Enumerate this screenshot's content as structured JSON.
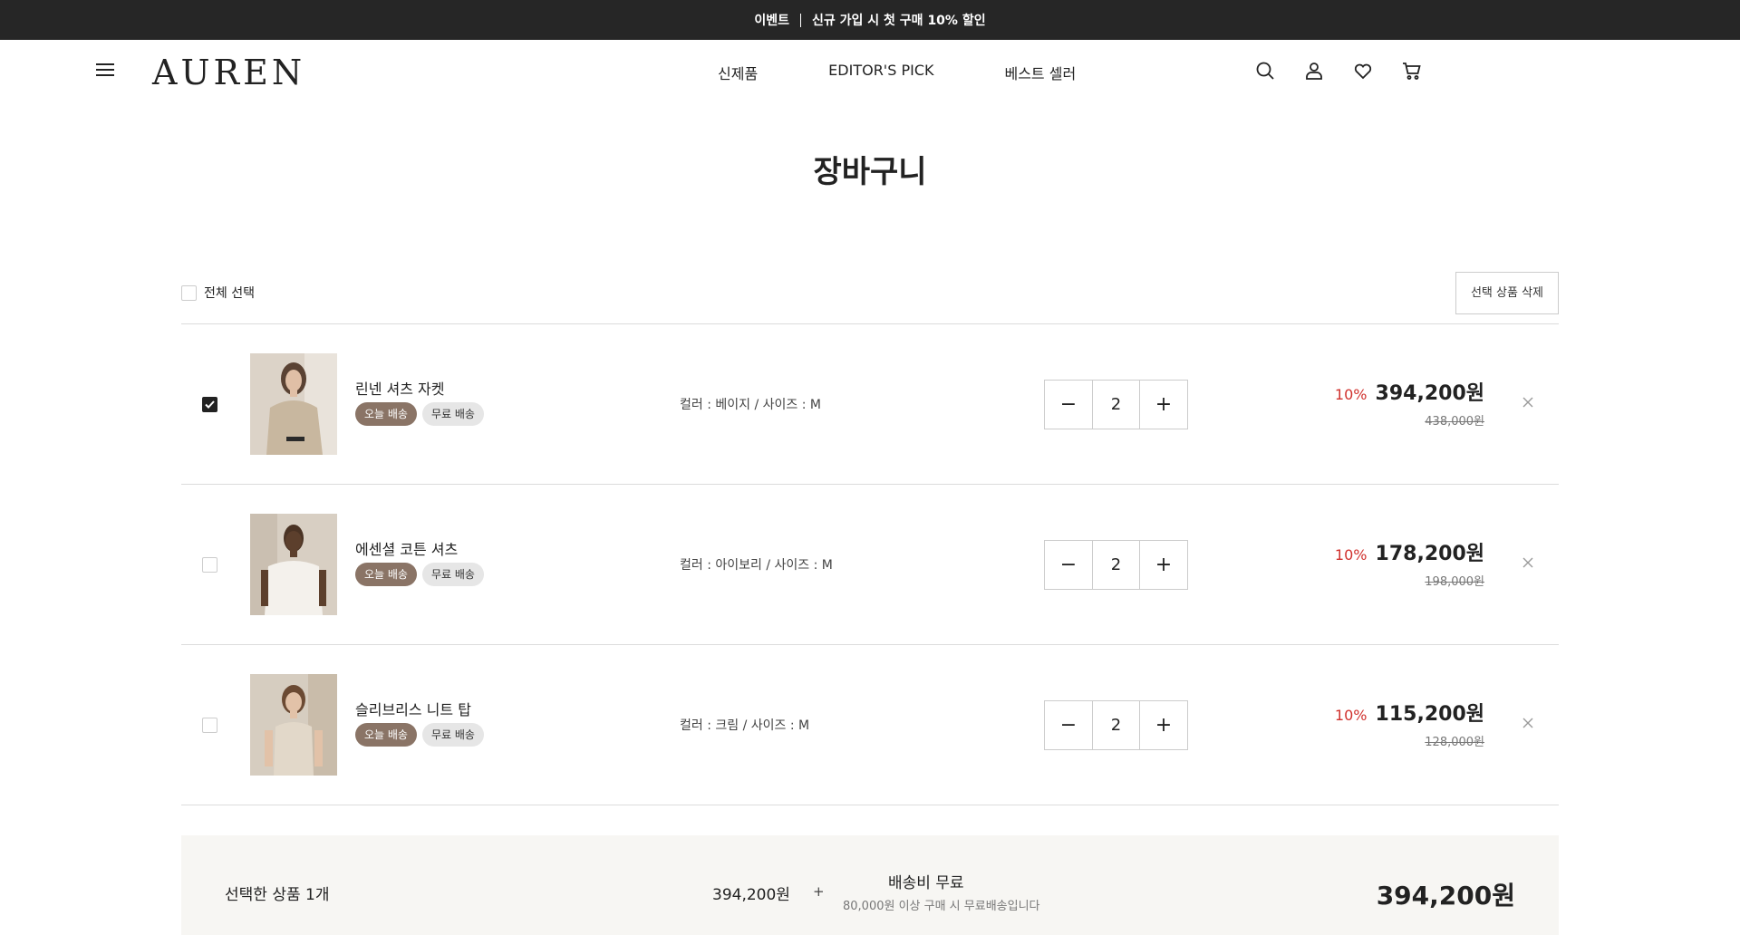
{
  "topbar": {
    "label": "이벤트",
    "text": "신규 가입 시 첫 구매 10% 할인"
  },
  "header": {
    "logo": "AUREN",
    "nav": [
      "신제품",
      "EDITOR'S PICK",
      "베스트 셀러"
    ]
  },
  "page": {
    "title": "장바구니"
  },
  "toolbar": {
    "select_all": "전체 선택",
    "delete_selected": "선택 상품 삭제"
  },
  "items": [
    {
      "name": "린넨 셔츠 자켓",
      "badge_today": "오늘 배송",
      "badge_free": "무료 배송",
      "option": "컬러 : 베이지 / 사이즈 : M",
      "qty": "2",
      "discount": "10%",
      "price": "394,200원",
      "original": "438,000원",
      "checked": true
    },
    {
      "name": "에센셜 코튼 셔츠",
      "badge_today": "오늘 배송",
      "badge_free": "무료 배송",
      "option": "컬러 : 아이보리 / 사이즈 : M",
      "qty": "2",
      "discount": "10%",
      "price": "178,200원",
      "original": "198,000원",
      "checked": false
    },
    {
      "name": "슬리브리스 니트 탑",
      "badge_today": "오늘 배송",
      "badge_free": "무료 배송",
      "option": "컬러 : 크림 / 사이즈 : M",
      "qty": "2",
      "discount": "10%",
      "price": "115,200원",
      "original": "128,000원",
      "checked": false
    }
  ],
  "summary": {
    "selected_label": "선택한 상품 1개",
    "amount": "394,200원",
    "plus": "+",
    "shipping": "배송비 무료",
    "shipping_note": "80,000원 이상 구매 시 무료배송입니다",
    "total": "394,200원"
  },
  "colors": {
    "topbar": "#262626",
    "badge_today": "#8a7466",
    "discount": "#d0312d",
    "summary_bg": "#f7f6f3"
  }
}
